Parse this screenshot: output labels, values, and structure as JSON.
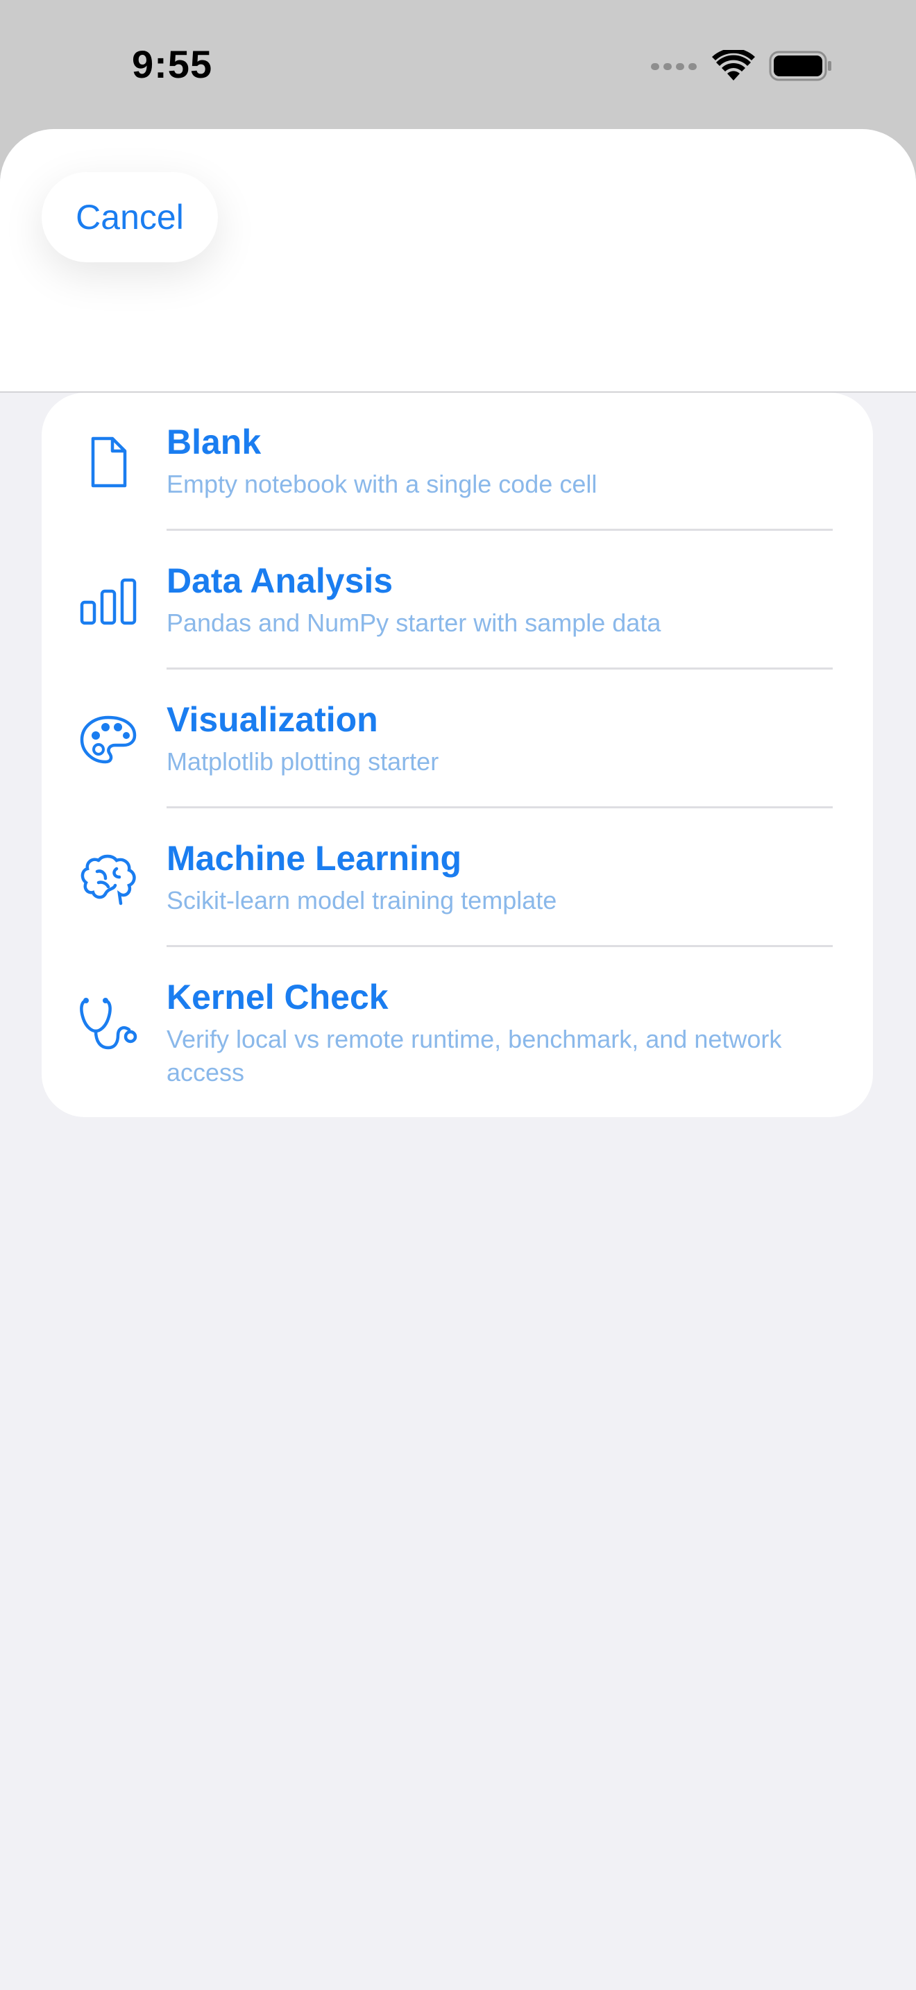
{
  "status_bar": {
    "time": "9:55",
    "icons": [
      "cellular-dots-icon",
      "wifi-icon",
      "battery-icon"
    ]
  },
  "header": {
    "cancel_label": "Cancel"
  },
  "templates": [
    {
      "icon": "document-icon",
      "title": "Blank",
      "subtitle": "Empty notebook with a single code cell"
    },
    {
      "icon": "bar-chart-icon",
      "title": "Data Analysis",
      "subtitle": "Pandas and NumPy starter with sample data"
    },
    {
      "icon": "palette-icon",
      "title": "Visualization",
      "subtitle": "Matplotlib plotting starter"
    },
    {
      "icon": "brain-icon",
      "title": "Machine Learning",
      "subtitle": "Scikit-learn model training template"
    },
    {
      "icon": "stethoscope-icon",
      "title": "Kernel Check",
      "subtitle": "Verify local vs remote runtime, benchmark, and network access"
    }
  ],
  "colors": {
    "accent": "#1a7df0",
    "subtitle": "#8ab8ea",
    "sheet_background": "#f1f1f5",
    "dimmed_background": "#cbcbcb"
  }
}
